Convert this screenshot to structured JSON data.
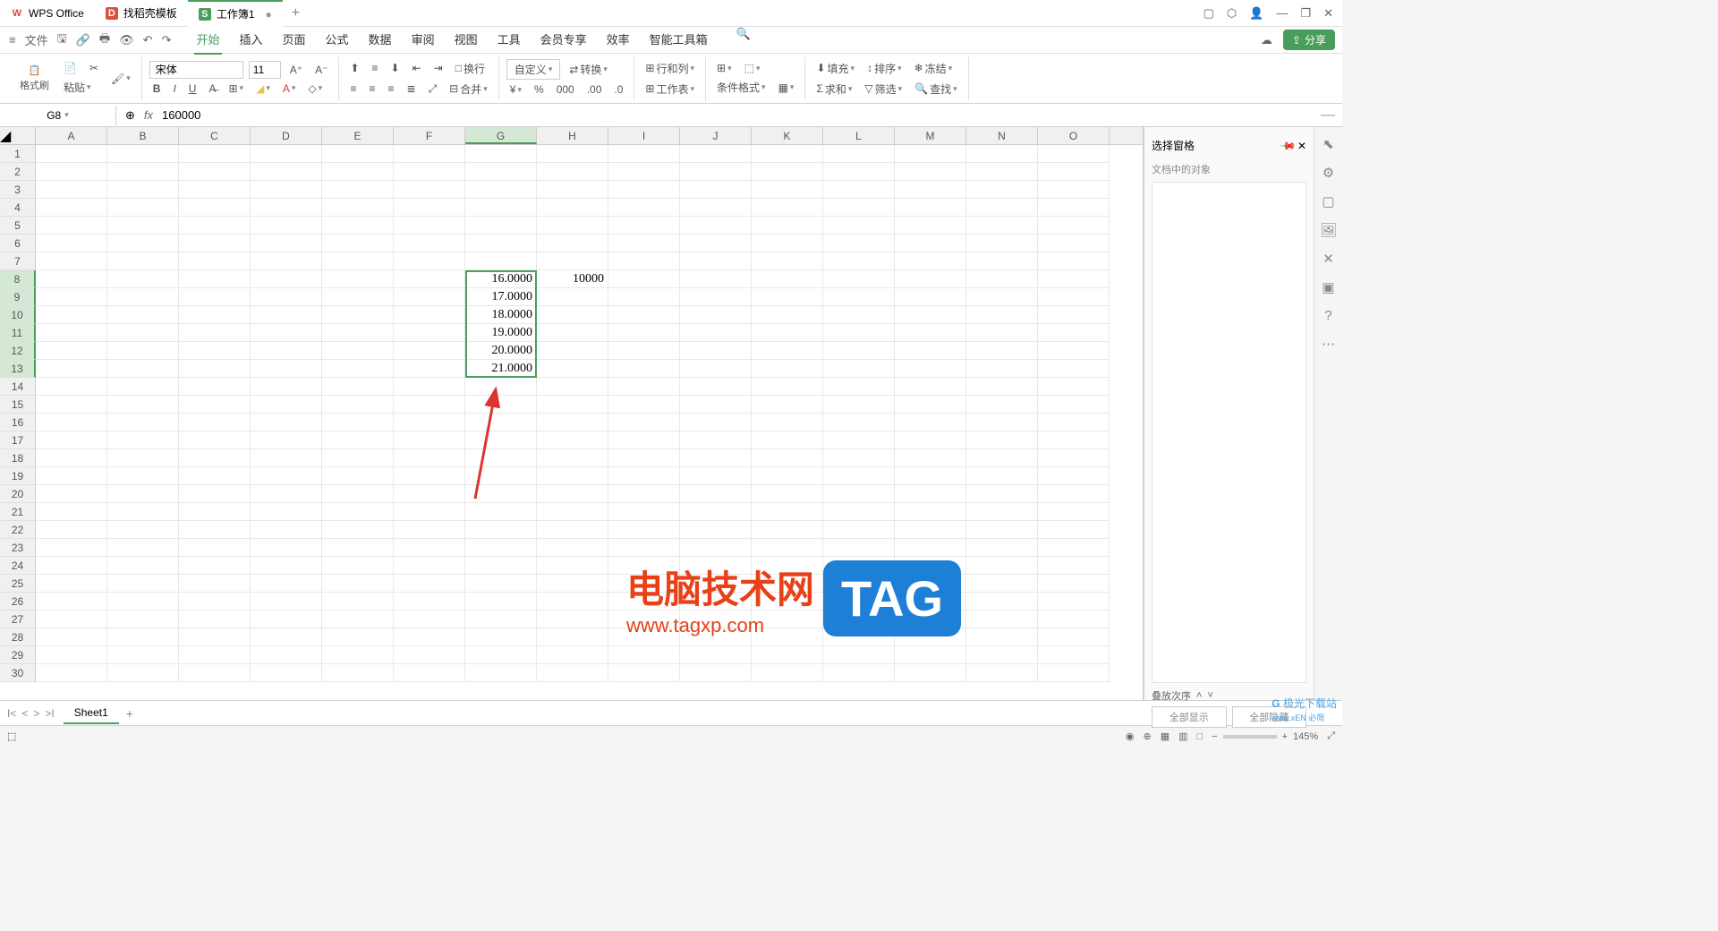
{
  "tabs": [
    {
      "label": "WPS Office"
    },
    {
      "label": "找稻壳模板"
    },
    {
      "label": "工作簿1",
      "modified": "●"
    }
  ],
  "menu": {
    "file": "文件",
    "items": [
      "开始",
      "插入",
      "页面",
      "公式",
      "数据",
      "审阅",
      "视图",
      "工具",
      "会员专享",
      "效率",
      "智能工具箱"
    ],
    "active": 0,
    "share": "分享"
  },
  "toolbar": {
    "formatBrush": "格式刷",
    "paste": "粘贴",
    "font": "宋体",
    "size": "11",
    "custom": "自定义",
    "convert": "转换",
    "rowcol": "行和列",
    "worksheet": "工作表",
    "condFormat": "条件格式",
    "fill": "填充",
    "sort": "排序",
    "freeze": "冻结",
    "sum": "求和",
    "filter": "筛选",
    "find": "查找",
    "wrap": "换行",
    "merge": "合并"
  },
  "formula": {
    "cellRef": "G8",
    "fx": "fx",
    "value": "160000"
  },
  "columns": [
    "A",
    "B",
    "C",
    "D",
    "E",
    "F",
    "G",
    "H",
    "I",
    "J",
    "K",
    "L",
    "M",
    "N",
    "O"
  ],
  "rowCount": 30,
  "cells": {
    "G8": "16.0000",
    "G9": "17.0000",
    "G10": "18.0000",
    "G11": "19.0000",
    "G12": "20.0000",
    "G13": "21.0000",
    "H8": "10000"
  },
  "selection": {
    "startCol": "G",
    "endCol": "G",
    "startRow": 8,
    "endRow": 13,
    "activeCell": "G8",
    "selectedRows": [
      8,
      9,
      10,
      11,
      12,
      13
    ]
  },
  "rightPanel": {
    "title": "选择窗格",
    "sub": "文档中的对象",
    "order": "叠放次序",
    "showAll": "全部显示",
    "hideAll": "全部隐藏"
  },
  "sheets": {
    "active": "Sheet1"
  },
  "status": {
    "zoom": "145%"
  },
  "watermark": {
    "text": "电脑技术网",
    "url": "www.tagxp.com",
    "tag": "TAG"
  },
  "logo": {
    "text": "极光下载站",
    "sub": "www.xEN 必简"
  }
}
